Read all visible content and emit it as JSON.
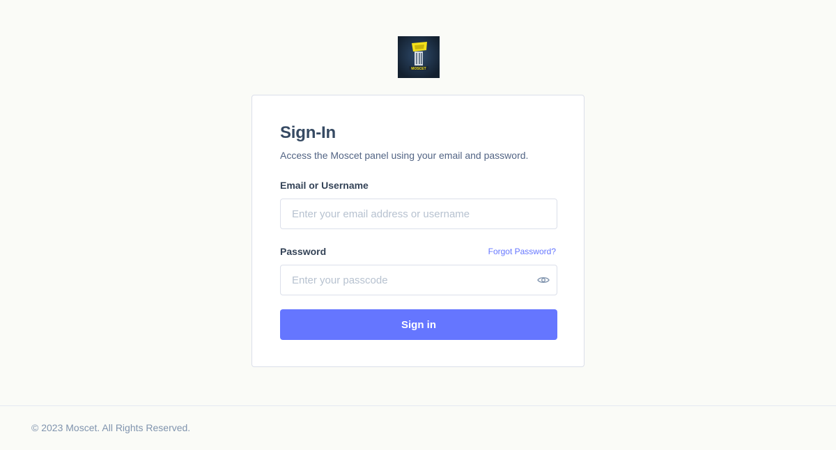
{
  "brand": {
    "logo_text": "MOSCET",
    "accent_color": "#6576ff",
    "logo_colors": [
      "#1c2a3c",
      "#f4e11a"
    ]
  },
  "signin": {
    "title": "Sign-In",
    "subtitle": "Access the Moscet panel using your email and password.",
    "email_label": "Email or Username",
    "email_placeholder": "Enter your email address or username",
    "email_value": "",
    "password_label": "Password",
    "forgot_link": "Forgot Password?",
    "password_placeholder": "Enter your passcode",
    "password_value": "",
    "toggle_icon": "eye-icon",
    "submit_label": "Sign in"
  },
  "footer": {
    "copyright": "© 2023 Moscet. All Rights Reserved."
  }
}
